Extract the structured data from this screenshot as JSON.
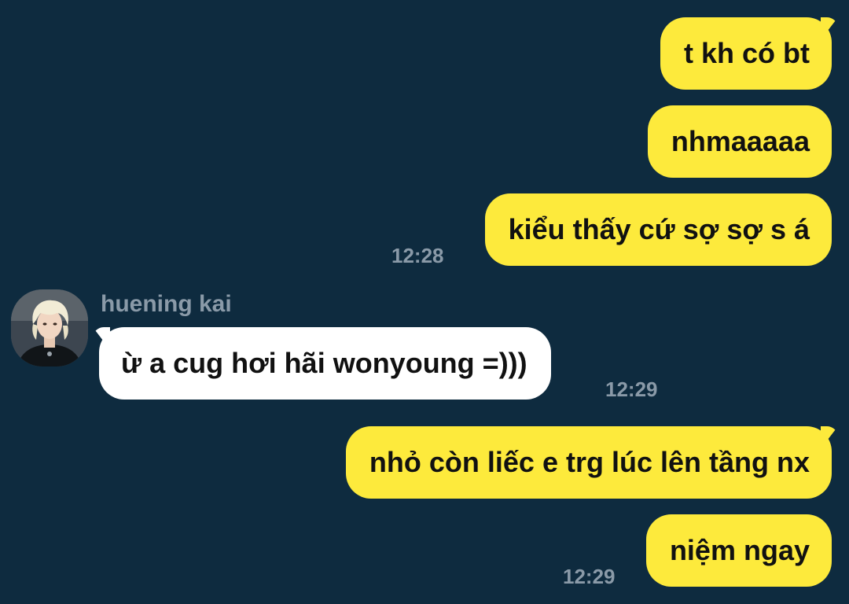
{
  "messages": {
    "m1": "t kh có bt",
    "m2": "nhmaaaaa",
    "m3": "kiểu thấy cứ sợ sợ s á",
    "t1": "12:28",
    "sender": "huening kai",
    "m4": "ừ a cug hơi hãi wonyoung =)))",
    "t2": "12:29",
    "m5": "nhỏ còn liếc e trg lúc lên tầng nx",
    "m6": "niệm ngay",
    "t3": "12:29"
  },
  "colors": {
    "background": "#0e2b3f",
    "outgoing_bubble": "#fdea3c",
    "incoming_bubble": "#ffffff",
    "meta_text": "#8a9aa8"
  }
}
